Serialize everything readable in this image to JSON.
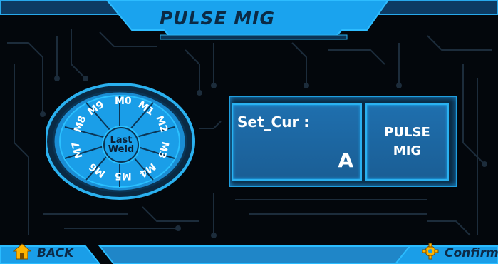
{
  "header": {
    "title": "PULSE MIG"
  },
  "memory_dial": {
    "center_line1": "Last",
    "center_line2": "Weld",
    "slots": [
      "M0",
      "M1",
      "M2",
      "M3",
      "M4",
      "M5",
      "M6",
      "M7",
      "M8",
      "M9"
    ]
  },
  "setting_panel": {
    "current_label": "Set_Cur :",
    "current_unit": "A",
    "mode_line1": "PULSE",
    "mode_line2": "MIG"
  },
  "footer": {
    "back_label": "BACK",
    "confirm_label": "Confirm"
  },
  "colors": {
    "accent": "#1aa0ea",
    "panel": "#1f6fae",
    "background": "#03070c",
    "trace": "#1a2a3a"
  },
  "icons": {
    "back": "home-icon",
    "confirm": "gear-icon"
  }
}
